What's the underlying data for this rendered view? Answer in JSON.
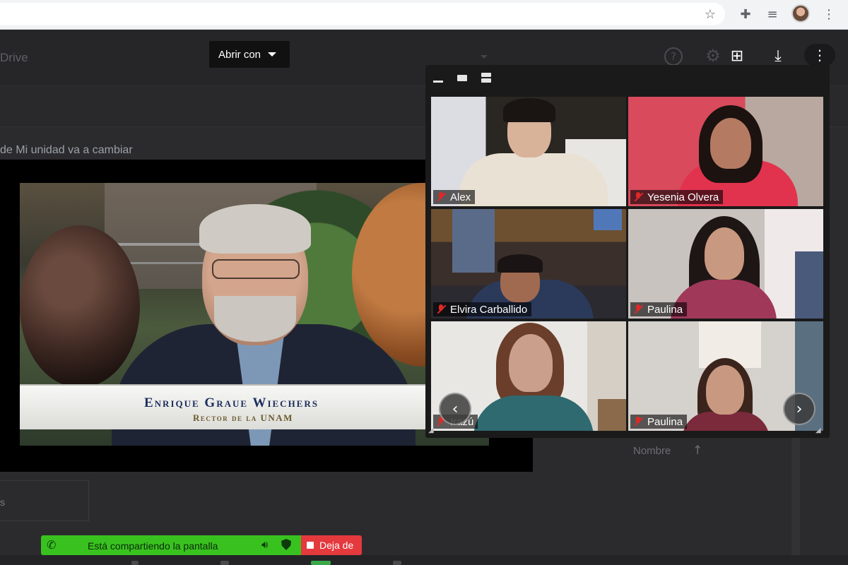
{
  "browser": {
    "icons": [
      "star-icon",
      "extensions-icon",
      "media-controls-icon",
      "profile-avatar",
      "menu-icon"
    ]
  },
  "drive": {
    "title": "Drive",
    "open_with_label": "Abrir con",
    "notice": "de Mi unidad va a cambiar",
    "sort_label": "Nombre",
    "left_card_text": "s",
    "icons": [
      "help-icon",
      "gear-icon",
      "add-comment-icon",
      "download-icon",
      "more-icon"
    ]
  },
  "main_video": {
    "speaker_name": "Enrique Graue Wiechers",
    "speaker_role": "Rector de la UNAM"
  },
  "zoom_gallery": {
    "participants": [
      {
        "name": "Alex",
        "muted": true
      },
      {
        "name": "Yesenia Olvera",
        "muted": true
      },
      {
        "name": "Elvira Carballido",
        "muted": true
      },
      {
        "name": "Paulina",
        "muted": true
      },
      {
        "name": "Irazú",
        "muted": true
      },
      {
        "name": "Paulina",
        "muted": true
      }
    ],
    "view_modes": [
      "minimize",
      "speaker",
      "split",
      "gallery"
    ],
    "active_view": "gallery",
    "accent_color": "#2d8cff"
  },
  "share_bar": {
    "status_text": "Está compartiendo la pantalla",
    "stop_label": "Deja de",
    "bar_color": "#39c21f",
    "stop_color": "#e4393d"
  }
}
